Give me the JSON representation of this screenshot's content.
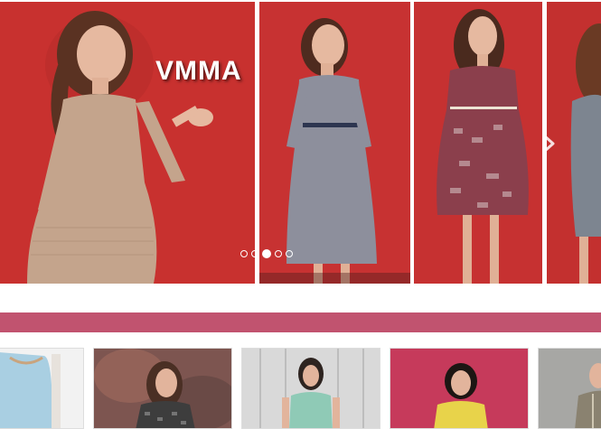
{
  "banner": {
    "brand_text": "VMMA",
    "next_icon": "chevron-right-icon",
    "slides": [
      {
        "name": "beige-dress",
        "background": "#c8312f",
        "dress_color": "#c4a48c"
      },
      {
        "name": "grey-dress",
        "background": "#c73232",
        "dress_color": "#8d8f9c"
      },
      {
        "name": "burgundy-print-dress",
        "background": "#c63131",
        "dress_color": "#8b3f4c"
      },
      {
        "name": "grey-sheath-dress",
        "background": "#c3302f",
        "dress_color": "#7d8590"
      }
    ],
    "pagination": {
      "count": 5,
      "active_index": 2
    }
  },
  "colors": {
    "accent_bar": "#c1536f",
    "banner_red": "#c8312f"
  },
  "thumbnails": [
    {
      "name": "blue-dress",
      "background": "#f2f2f2",
      "dress_color": "#a9cfe2"
    },
    {
      "name": "patterned-dress-dark",
      "background": "#7d5550",
      "dress_color": "#3d3d3d"
    },
    {
      "name": "mint-dress",
      "background": "#d9d9d9",
      "dress_color": "#8fcab6"
    },
    {
      "name": "yellow-dress",
      "background": "#c63a5b",
      "dress_color": "#e8d34a"
    },
    {
      "name": "grey-jacket",
      "background": "#a7a7a4",
      "dress_color": "#8a8270"
    }
  ]
}
